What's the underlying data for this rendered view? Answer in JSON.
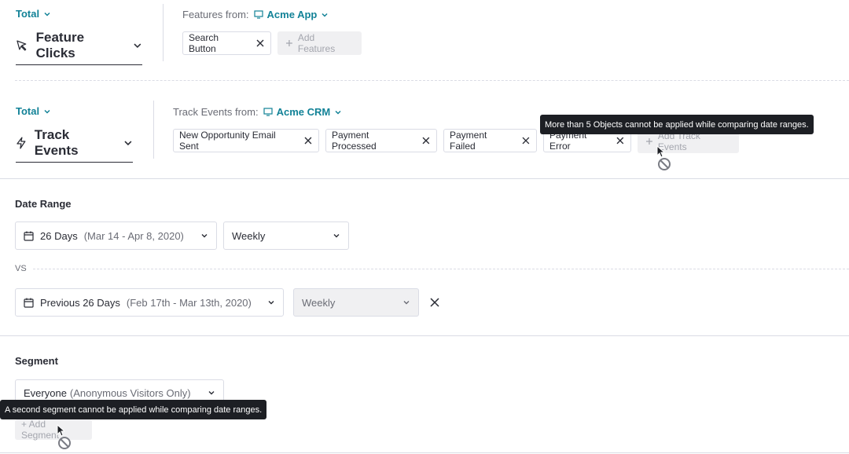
{
  "metric1": {
    "aggregation": "Total",
    "name": "Feature Clicks",
    "from_label": "Features from:",
    "app": "Acme App",
    "chips": [
      "Search Button"
    ],
    "add_label": "Add Features"
  },
  "metric2": {
    "aggregation": "Total",
    "name": "Track Events",
    "from_label": "Track Events from:",
    "app": "Acme CRM",
    "chips": [
      "New Opportunity Email Sent",
      "Payment Processed",
      "Payment Failed",
      "Payment Error"
    ],
    "add_label": "Add Track Events",
    "tooltip": "More than 5 Objects cannot be applied while comparing date ranges."
  },
  "date_range": {
    "title": "Date Range",
    "primary": {
      "label": "26 Days",
      "detail": "(Mar 14 - Apr 8, 2020)",
      "interval": "Weekly"
    },
    "vs_label": "VS",
    "compare": {
      "label": "Previous 26 Days",
      "detail": "(Feb 17th - Mar 13th, 2020)",
      "interval": "Weekly"
    }
  },
  "segment": {
    "title": "Segment",
    "selected": "Everyone",
    "selected_detail": "(Anonymous Visitors Only)",
    "add_label": "+ Add Segment",
    "tooltip": "A second segment cannot be applied while comparing date ranges."
  },
  "colors": {
    "accent": "#128297",
    "text": "#2a2c35",
    "border": "#dadce5",
    "tooltip_bg": "#1d1f24"
  }
}
